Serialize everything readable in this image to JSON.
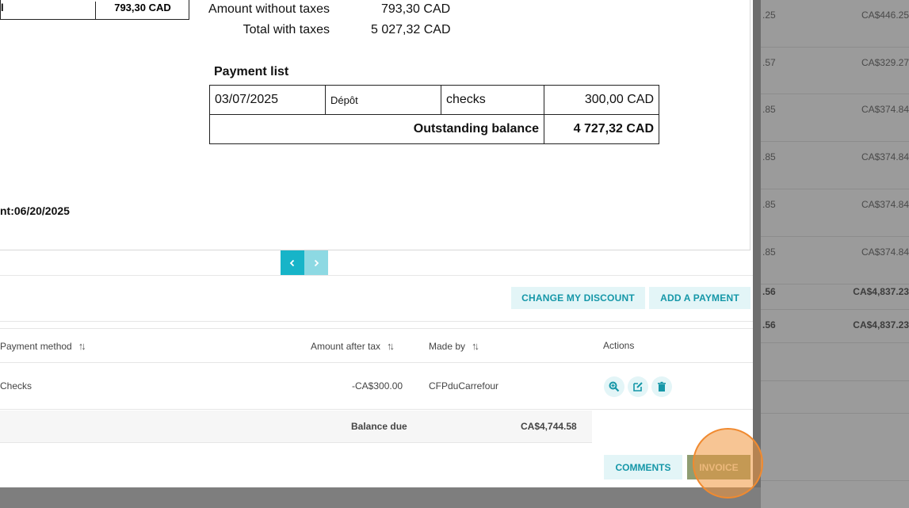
{
  "background": {
    "rows": [
      {
        "c1": ".25",
        "c2": "CA$446.25"
      },
      {
        "c1": ".57",
        "c2": "CA$329.27"
      },
      {
        "c1": ".85",
        "c2": "CA$374.84"
      },
      {
        "c1": ".85",
        "c2": "CA$374.84"
      },
      {
        "c1": ".85",
        "c2": "CA$374.84"
      },
      {
        "c1": ".85",
        "c2": "CA$374.84"
      },
      {
        "c1": ".56",
        "c2": "CA$4,837.23"
      },
      {
        "c1": ".56",
        "c2": "CA$4,837.23"
      }
    ]
  },
  "preview": {
    "total_label": "l",
    "total_value": "793,30 CAD",
    "amount_without_taxes_label": "Amount without taxes",
    "amount_without_taxes_value": "793,30 CAD",
    "total_with_taxes_label": "Total with taxes",
    "total_with_taxes_value": "5 027,32 CAD",
    "payment_list_title": "Payment list",
    "payment": {
      "date": "03/07/2025",
      "type": "Dépôt",
      "method": "checks",
      "amount": "300,00 CAD"
    },
    "outstanding_label": "Outstanding balance",
    "outstanding_value": "4 727,32 CAD",
    "date_text": "nt:06/20/2025"
  },
  "pager": {
    "prev": "‹",
    "next": "›"
  },
  "actions": {
    "change_discount": "CHANGE MY DISCOUNT",
    "add_payment": "ADD A PAYMENT"
  },
  "table": {
    "headers": {
      "payment_method": "Payment method",
      "amount_after_tax": "Amount after tax",
      "made_by": "Made by",
      "actions": "Actions"
    },
    "row": {
      "method": "Checks",
      "amount": "-CA$300.00",
      "made_by": "CFPduCarrefour"
    },
    "balance_label": "Balance due",
    "balance_value": "CA$4,744.58"
  },
  "footer": {
    "comments": "COMMENTS",
    "invoice": "INVOICE"
  },
  "colors": {
    "accent": "#17b4c8",
    "accent_light": "#e3f5f7",
    "highlight": "#f08a30"
  }
}
